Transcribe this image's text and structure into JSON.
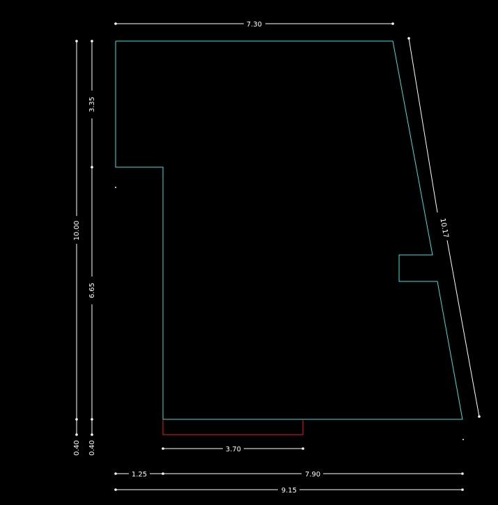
{
  "plan": {
    "wall_color": "#40e0e0",
    "door_color": "#e02020",
    "dimension_color": "#ffffff",
    "background": "#000000"
  },
  "dimensions": {
    "top_width": "7.30",
    "right_slope": "10.17",
    "left_total": "10.00",
    "left_bottom_outer": "0.40",
    "left_upper": "3.35",
    "left_lower": "6.65",
    "left_bottom_inner": "0.40",
    "door_width": "3.70",
    "bottom_left": "1.25",
    "bottom_right": "7.90",
    "bottom_total": "9.15"
  }
}
